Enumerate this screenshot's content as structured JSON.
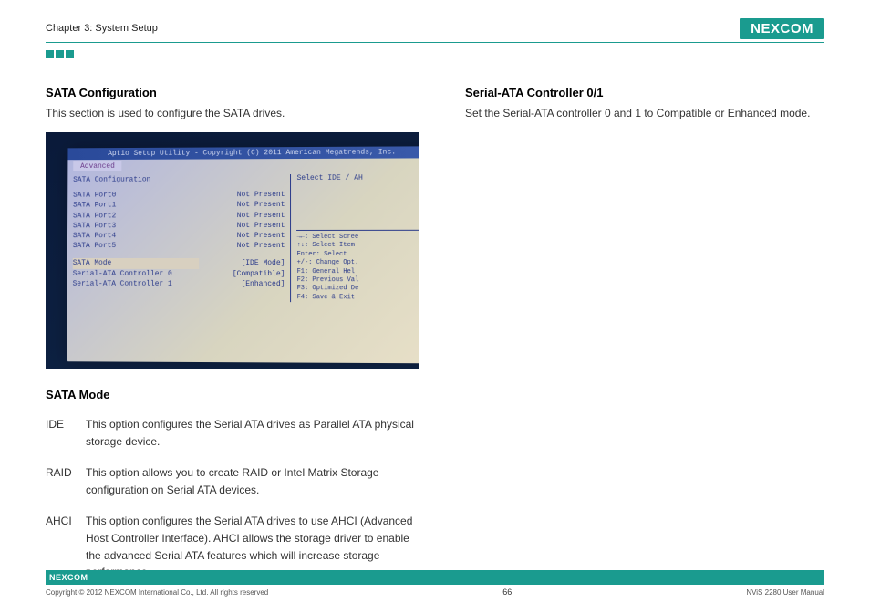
{
  "header": {
    "chapter": "Chapter 3: System Setup",
    "brand": "NEXCOM"
  },
  "left": {
    "sata_config_heading": "SATA Configuration",
    "sata_config_text": "This section is used to configure the SATA drives.",
    "sata_mode_heading": "SATA Mode",
    "modes": [
      {
        "label": "IDE",
        "desc": "This option configures the Serial ATA drives as Parallel ATA physical storage device."
      },
      {
        "label": "RAID",
        "desc": "This option allows you to create RAID or Intel Matrix Storage configuration on Serial ATA devices."
      },
      {
        "label": "AHCI",
        "desc": "This option configures the Serial ATA drives to use AHCI (Advanced Host Controller Interface). AHCI allows the storage driver to enable the advanced Serial ATA features which will increase storage performance."
      }
    ]
  },
  "right": {
    "heading": "Serial-ATA Controller 0/1",
    "text": "Set the Serial-ATA controller 0 and 1 to Compatible or Enhanced mode."
  },
  "bios": {
    "title": "Aptio Setup Utility - Copyright (C) 2011 American Megatrends, Inc.",
    "tab": "Advanced",
    "section": "SATA Configuration",
    "ports": [
      {
        "name": "SATA Port0",
        "status": "Not Present"
      },
      {
        "name": "SATA Port1",
        "status": "Not Present"
      },
      {
        "name": "SATA Port2",
        "status": "Not Present"
      },
      {
        "name": "SATA Port3",
        "status": "Not Present"
      },
      {
        "name": "SATA Port4",
        "status": "Not Present"
      },
      {
        "name": "SATA Port5",
        "status": "Not Present"
      }
    ],
    "settings": [
      {
        "name": "SATA Mode",
        "value": "[IDE Mode]"
      },
      {
        "name": "Serial-ATA Controller 0",
        "value": "[Compatible]"
      },
      {
        "name": "Serial-ATA Controller 1",
        "value": "[Enhanced]"
      }
    ],
    "help_top": "Select IDE / AH",
    "help": [
      "→←: Select Scree",
      "↑↓: Select Item",
      "Enter: Select",
      "+/-: Change Opt.",
      "F1: General Hel",
      "F2: Previous Val",
      "F3: Optimized De",
      "F4: Save & Exit"
    ]
  },
  "footer": {
    "mini_brand": "NEXCOM",
    "copyright": "Copyright © 2012 NEXCOM International Co., Ltd. All rights reserved",
    "page_number": "66",
    "doc": "NViS 2280 User Manual"
  }
}
